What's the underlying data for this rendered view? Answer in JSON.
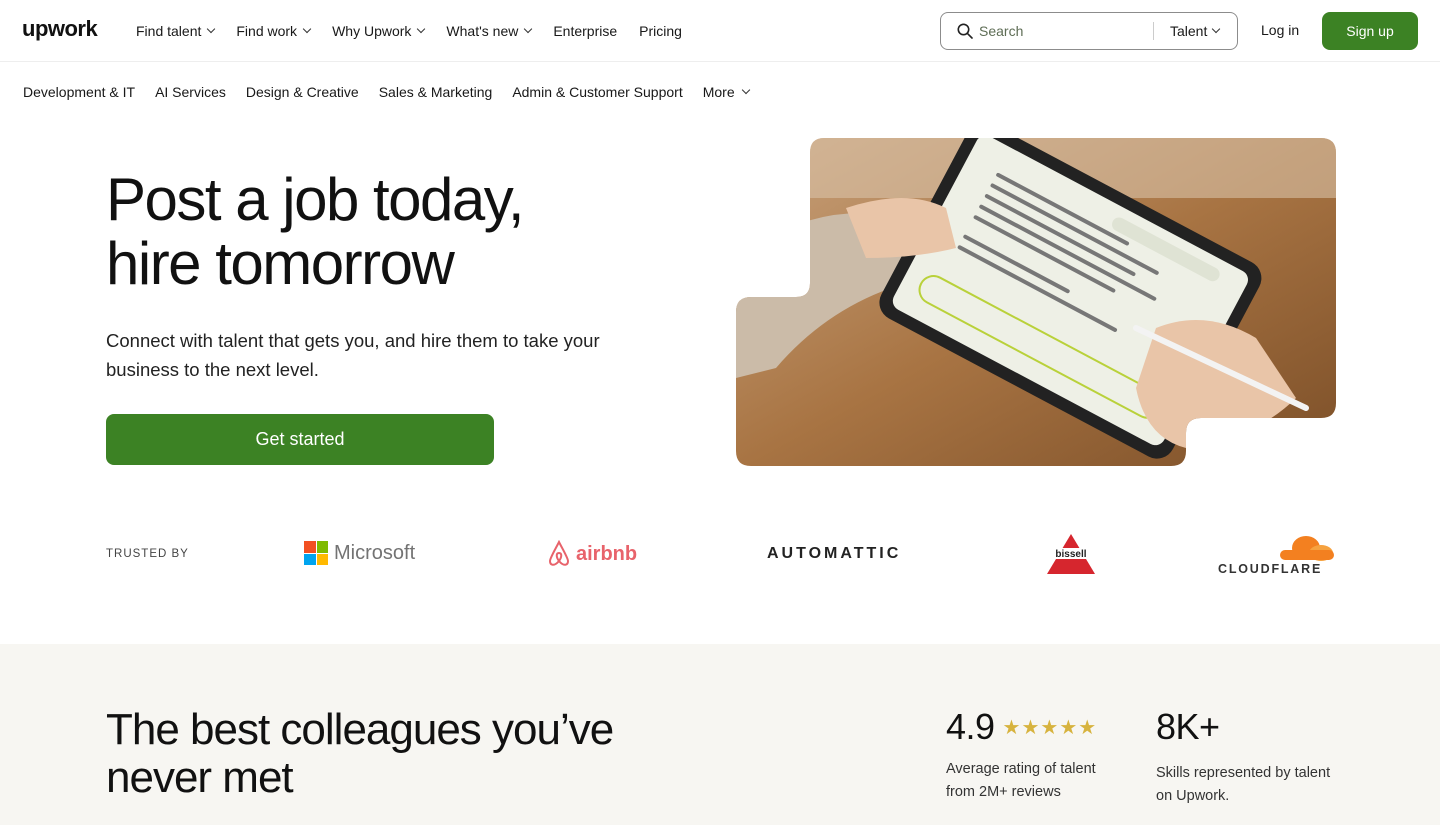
{
  "header": {
    "logo": "upwork",
    "nav": [
      {
        "label": "Find talent",
        "dropdown": true
      },
      {
        "label": "Find work",
        "dropdown": true
      },
      {
        "label": "Why Upwork",
        "dropdown": true
      },
      {
        "label": "What's new",
        "dropdown": true
      },
      {
        "label": "Enterprise",
        "dropdown": false
      },
      {
        "label": "Pricing",
        "dropdown": false
      }
    ],
    "search": {
      "placeholder": "Search",
      "type": "Talent"
    },
    "login": "Log in",
    "signup": "Sign up"
  },
  "categories": [
    "Development & IT",
    "AI Services",
    "Design & Creative",
    "Sales & Marketing",
    "Admin & Customer Support",
    "More"
  ],
  "hero": {
    "title_line1": "Post a job today,",
    "title_line2": "hire tomorrow",
    "subtitle": "Connect with talent that gets you, and hire them to take your business to the next level.",
    "cta": "Get started"
  },
  "trusted": {
    "label": "TRUSTED BY",
    "logos": [
      "Microsoft",
      "airbnb",
      "AUTOMATTIC",
      "bissell",
      "CLOUDFLARE"
    ]
  },
  "stats_section": {
    "title": "The best colleagues you’ve never met",
    "stats": [
      {
        "value": "4.9",
        "stars": "★★★★★",
        "desc": "Average rating of talent from 2M+ reviews"
      },
      {
        "value": "8K+",
        "desc": "Skills represented by talent on Upwork."
      }
    ]
  },
  "colors": {
    "brand_green": "#3c8224",
    "star": "#d7b33e",
    "airbnb": "#e8636b",
    "cloudflare": "#f38020",
    "bissell": "#d6262e"
  }
}
